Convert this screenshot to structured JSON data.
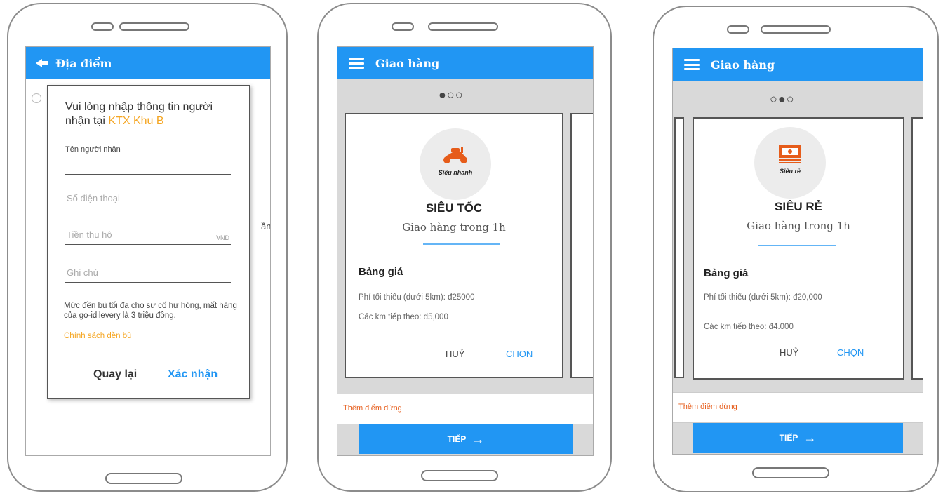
{
  "phone1": {
    "title": "Địa điểm",
    "dialog": {
      "heading": "Vui lòng nhập thông tin người nhận tại ",
      "highlight": "KTX Khu B",
      "recipient_label": "Tên người nhận",
      "phone_placeholder": "Số điện thoại",
      "cod_placeholder": "Tiền thu hộ",
      "cod_unit": "VND",
      "note_placeholder": "Ghi chú",
      "compensation_text": "Mức đền bù tối đa cho sự cố hư hỏng, mất hàng của go-idilevery là 3 triệu đồng.",
      "policy_link": "Chính sách đền bù",
      "back_button": "Quay lại",
      "confirm_button": "Xác nhận"
    },
    "behind_text": "ần"
  },
  "phone2": {
    "title": "Giao hàng",
    "dots": "●○○",
    "badge_label": "Siêu nhanh",
    "card_title": "SIÊU TỐC",
    "card_subtitle": "Giao hàng trong 1h",
    "price_heading": "Bảng giá",
    "price_min": "Phí tối thiểu (dưới 5km): đ25000",
    "price_next": "Các km tiếp theo: đ5,000",
    "cancel_button": "HUỶ",
    "choose_button": "CHỌN",
    "add_stop": "Thêm điểm dừng",
    "next_button": "TIẾP"
  },
  "phone3": {
    "title": "Giao hàng",
    "dots": "○●○",
    "badge_label": "Siêu rẻ",
    "card_title": "SIÊU RẺ",
    "card_subtitle": "Giao hàng trong 1h",
    "price_heading": "Bảng giá",
    "price_min": "Phí tối thiểu (dưới 5km): đ20,000",
    "price_next": "Các km tiếp theo: đ4,000",
    "cancel_button": "HUỶ",
    "choose_button": "CHỌN",
    "add_stop": "Thêm điểm dừng",
    "next_button": "TIẾP"
  },
  "colors": {
    "primary": "#2196f3",
    "accent": "#f5a623",
    "orange": "#e65c1a"
  }
}
